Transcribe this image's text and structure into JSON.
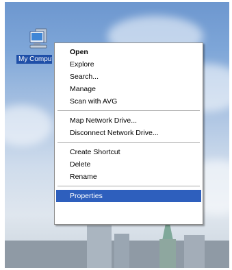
{
  "desktop": {
    "icon": {
      "name": "computer-icon",
      "label": "My Computer"
    }
  },
  "context_menu": {
    "items": [
      {
        "label": "Open",
        "bold": true
      },
      {
        "label": "Explore"
      },
      {
        "label": "Search..."
      },
      {
        "label": "Manage"
      },
      {
        "label": "Scan with AVG"
      },
      {
        "label": "Map Network Drive..."
      },
      {
        "label": "Disconnect Network Drive..."
      },
      {
        "label": "Create Shortcut"
      },
      {
        "label": "Delete"
      },
      {
        "label": "Rename"
      },
      {
        "label": "Properties",
        "selected": true
      }
    ]
  },
  "colors": {
    "selection": "#2e5fbd",
    "icon_label_bg": "#1f4fa8",
    "menu_border": "#8a8a8a"
  }
}
